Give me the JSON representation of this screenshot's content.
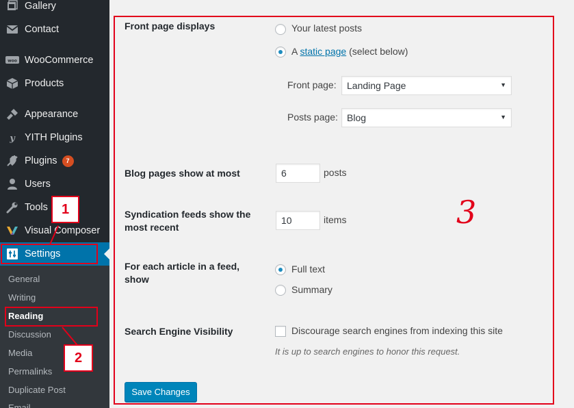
{
  "sidebar": {
    "items": [
      {
        "label": "Gallery",
        "icon": "gallery-icon"
      },
      {
        "label": "Contact",
        "icon": "mail-icon"
      },
      {
        "label": "WooCommerce",
        "icon": "woocommerce-icon"
      },
      {
        "label": "Products",
        "icon": "box-icon"
      },
      {
        "label": "Appearance",
        "icon": "brush-icon"
      },
      {
        "label": "YITH Plugins",
        "icon": "yith-icon"
      },
      {
        "label": "Plugins",
        "icon": "plug-icon",
        "badge": "7"
      },
      {
        "label": "Users",
        "icon": "user-icon"
      },
      {
        "label": "Tools",
        "icon": "wrench-icon"
      },
      {
        "label": "Visual Composer",
        "icon": "visual-composer-icon"
      },
      {
        "label": "Settings",
        "icon": "settings-icon",
        "active": true
      }
    ],
    "submenu": [
      "General",
      "Writing",
      "Reading",
      "Discussion",
      "Media",
      "Permalinks",
      "Duplicate Post",
      "Email"
    ]
  },
  "annotations": {
    "one": "1",
    "two": "2",
    "three": "3"
  },
  "settings": {
    "front_page_displays": {
      "label": "Front page displays",
      "latest_posts": "Your latest posts",
      "static_prefix": "A",
      "static_link": "static page",
      "static_suffix": "(select below)",
      "selected": "static page"
    },
    "front_page": {
      "label": "Front page:",
      "value": "Landing Page"
    },
    "posts_page": {
      "label": "Posts page:",
      "value": "Blog"
    },
    "blog_pages": {
      "label": "Blog pages show at most",
      "value": "6",
      "unit": "posts"
    },
    "syndication": {
      "label": "Syndication feeds show the most recent",
      "value": "10",
      "unit": "items"
    },
    "feed_article": {
      "label": "For each article in a feed, show",
      "full_text": "Full text",
      "summary": "Summary",
      "selected": "Full text"
    },
    "search_visibility": {
      "label": "Search Engine Visibility",
      "checkbox_label": "Discourage search engines from indexing this site",
      "checked": false,
      "hint": "It is up to search engines to honor this request."
    },
    "save_label": "Save Changes"
  },
  "colors": {
    "accent": "#0073aa",
    "annotation": "#e2001a",
    "sidebar_bg": "#23282d"
  }
}
